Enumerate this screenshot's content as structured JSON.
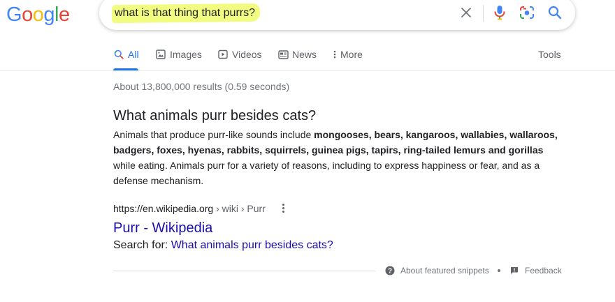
{
  "logo": {
    "letters": [
      "G",
      "o",
      "o",
      "g",
      "l",
      "e"
    ],
    "colors": [
      "#4285f4",
      "#ea4335",
      "#fbbc05",
      "#4285f4",
      "#34a853",
      "#ea4335"
    ]
  },
  "search": {
    "query": "what is that thing that purrs?",
    "clear_icon": "close-icon",
    "voice_icon": "microphone-icon",
    "lens_icon": "camera-lens-icon",
    "search_icon": "search-icon"
  },
  "tabs": [
    {
      "label": "All",
      "icon": "search-icon"
    },
    {
      "label": "Images",
      "icon": "image-icon"
    },
    {
      "label": "Videos",
      "icon": "play-icon"
    },
    {
      "label": "News",
      "icon": "newspaper-icon"
    },
    {
      "label": "More",
      "icon": "more-vert-icon"
    }
  ],
  "tools_label": "Tools",
  "stats": "About 13,800,000 results (0.59 seconds)",
  "snippet": {
    "question": "What animals purr besides cats?",
    "text_before": "Animals that produce purr-like sounds include ",
    "text_bold": "mongooses, bears, kangaroos, wallabies, wallaroos, badgers, foxes, hyenas, rabbits, squirrels, guinea pigs, tapirs, ring-tailed lemurs and gorillas",
    "text_after": " while eating. Animals purr for a variety of reasons, including to express happiness or fear, and as a defense mechanism."
  },
  "result": {
    "url_domain": "https://en.wikipedia.org",
    "url_path": " › wiki › Purr",
    "title": "Purr - Wikipedia",
    "search_for_label": "Search for: ",
    "search_for_link": "What animals purr besides cats?"
  },
  "footer": {
    "about_label": "About featured snippets",
    "feedback_label": "Feedback"
  },
  "colors": {
    "accent": "#1a73e8",
    "link": "#1a0dab",
    "highlight": "#eefb6a"
  }
}
